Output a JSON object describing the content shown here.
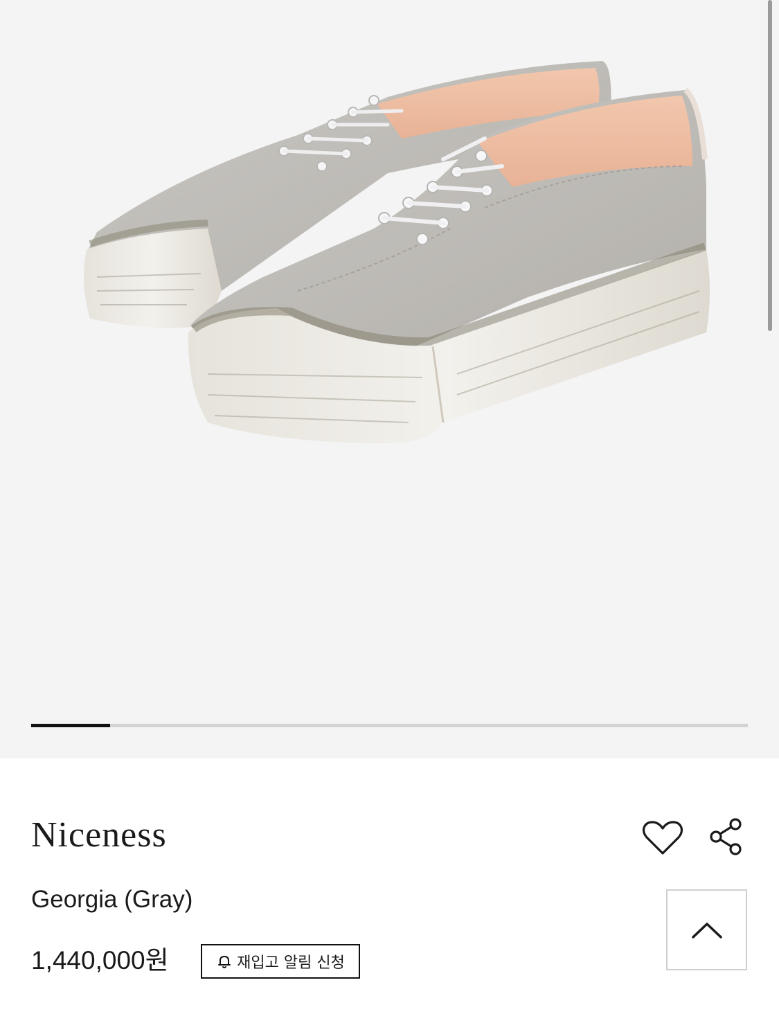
{
  "gallery": {
    "image_alt": "Gray suede lace-up sneakers with distressed white platform soles",
    "current_slide": 1,
    "slide_progress": 0.11
  },
  "product": {
    "brand": "Niceness",
    "name": "Georgia (Gray)",
    "price": "1,440,000원"
  },
  "actions": {
    "restock_label": "재입고 알림 신청",
    "wishlist_icon": "heart-icon",
    "share_icon": "share-icon",
    "scroll_top_icon": "chevron-up-icon"
  },
  "colors": {
    "gallery_bg": "#f4f4f5",
    "text": "#1a1a1a",
    "accent": "#111111"
  }
}
